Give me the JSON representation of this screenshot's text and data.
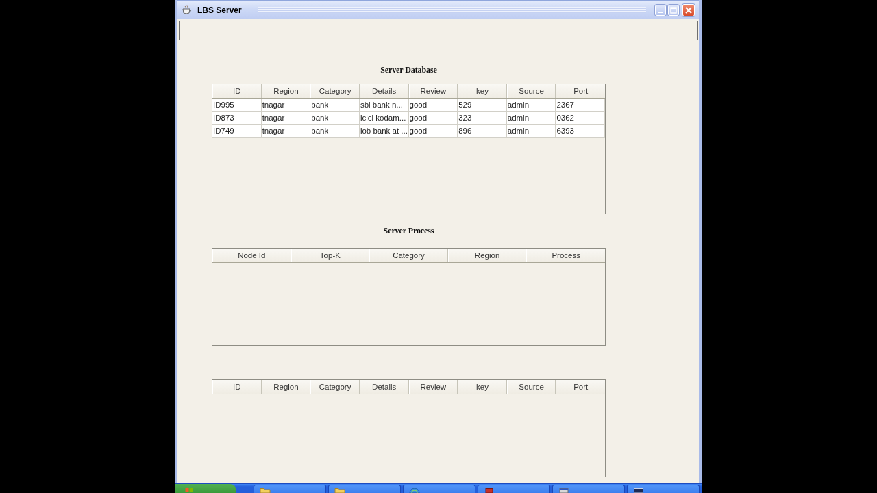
{
  "window": {
    "title": "LBS Server"
  },
  "tables": [
    {
      "title": "Server Database",
      "columns": [
        "ID",
        "Region",
        "Category",
        "Details",
        "Review",
        "key",
        "Source",
        "Port"
      ],
      "rows": [
        [
          "ID995",
          "tnagar",
          "bank",
          "sbi bank n...",
          "good",
          "529",
          "admin",
          "2367"
        ],
        [
          "ID873",
          "tnagar",
          "bank",
          "icici kodam...",
          "good",
          "323",
          "admin",
          "0362"
        ],
        [
          "ID749",
          "tnagar",
          "bank",
          "iob bank at ...",
          "good",
          "896",
          "admin",
          "6393"
        ]
      ]
    },
    {
      "title": "Server Process",
      "columns": [
        "Node Id",
        "Top-K",
        "Category",
        "Region",
        "Process"
      ]
    },
    {
      "columns": [
        "ID",
        "Region",
        "Category",
        "Details",
        "Review",
        "key",
        "Source",
        "Port"
      ]
    }
  ],
  "taskbar": {
    "items": [
      {
        "kind": "folder"
      },
      {
        "kind": "folder"
      },
      {
        "kind": "globe"
      },
      {
        "kind": "document"
      },
      {
        "kind": "program"
      },
      {
        "kind": "console"
      }
    ]
  }
}
